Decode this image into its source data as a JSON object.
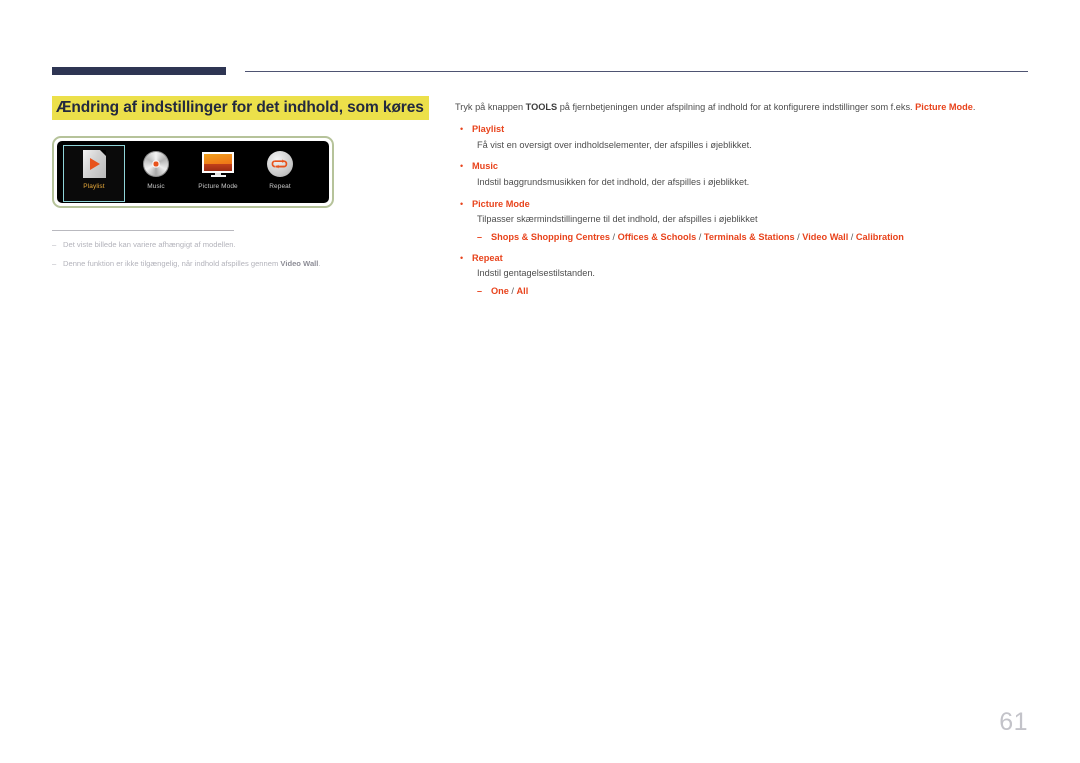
{
  "header": {
    "rule_color_thick": "#2e3553",
    "rule_color_thin": "#4e5472"
  },
  "left": {
    "title": "Ændring af indstillinger for det indhold, som køres",
    "title_highlight_color": "#ece04a",
    "title_text_color": "#23293f",
    "panel": {
      "background": "#000000",
      "border_color": "#b6c39a",
      "selection_color": "#8fd4d8",
      "selected_label_color": "#e8a93a",
      "tiles": [
        {
          "label": "Playlist",
          "icon": "playlist-document-play-icon",
          "selected": true
        },
        {
          "label": "Music",
          "icon": "music-cd-disc-icon",
          "selected": false
        },
        {
          "label": "Picture Mode",
          "icon": "picture-mode-monitor-icon",
          "selected": false
        },
        {
          "label": "Repeat",
          "icon": "repeat-loop-arrow-icon",
          "selected": false
        }
      ]
    },
    "footnotes": [
      {
        "dash": "–",
        "text": "Det viste billede kan variere afhængigt af modellen.",
        "bold_tail": ""
      },
      {
        "dash": "–",
        "text": "Denne funktion er ikke tilgængelig, når indhold afspilles gennem ",
        "bold_tail": "Video Wall",
        "tail_suffix": "."
      }
    ]
  },
  "right": {
    "intro": {
      "part1": "Tryk på knappen ",
      "bold1": "TOOLS",
      "part2": " på fjernbetjeningen under afspilning af indhold for at konfigurere indstillinger som f.eks. ",
      "highlight1": "Picture Mode",
      "part3": "."
    },
    "bullets": [
      {
        "marker": "•",
        "title": "Playlist",
        "desc": "Få vist en oversigt over indholdselementer, der afspilles i øjeblikket.",
        "sub": null
      },
      {
        "marker": "•",
        "title": "Music",
        "desc": "Indstil baggrundsmusikken for det indhold, der afspilles i øjeblikket.",
        "sub": null
      },
      {
        "marker": "•",
        "title": "Picture Mode",
        "desc": "Tilpasser skærmindstillingerne til det indhold, der afspilles i øjeblikket",
        "sub": {
          "dash": "–",
          "options": [
            "Shops & Shopping Centres",
            "Offices & Schools",
            "Terminals & Stations",
            "Video Wall",
            "Calibration"
          ],
          "separator": " / "
        }
      },
      {
        "marker": "•",
        "title": "Repeat",
        "desc": "Indstil gentagelsestilstanden.",
        "sub": {
          "dash": "–",
          "options": [
            "One",
            "All"
          ],
          "separator": " / "
        }
      }
    ],
    "accent_color": "#e8431c"
  },
  "footer": {
    "page_number": "61"
  }
}
